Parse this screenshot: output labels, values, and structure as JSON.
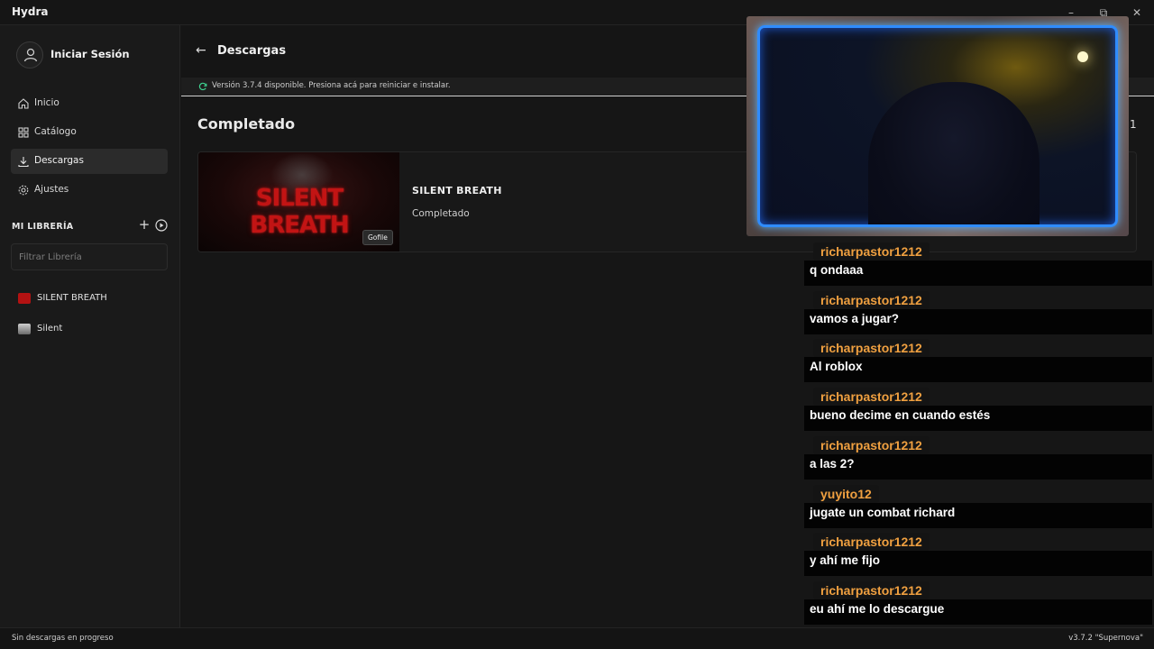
{
  "window": {
    "title": "Hydra",
    "controls": {
      "minimize": "–",
      "restore": "⧉",
      "close": "✕"
    }
  },
  "sidebar": {
    "user": {
      "label": "Iniciar Sesión",
      "icon": "user-icon"
    },
    "nav": [
      {
        "label": "Inicio",
        "icon": "home-icon",
        "active": false
      },
      {
        "label": "Catálogo",
        "icon": "grid-icon",
        "active": false
      },
      {
        "label": "Descargas",
        "icon": "download-icon",
        "active": true
      },
      {
        "label": "Ajustes",
        "icon": "gear-icon",
        "active": false
      }
    ],
    "library": {
      "heading": "MI LIBRERÍA",
      "add": "+",
      "filter_placeholder": "Filtrar Librería",
      "items": [
        {
          "label": "SILENT BREATH",
          "thumb_color": "#b31212"
        },
        {
          "label": "Silent",
          "thumb_color": "#8a8a8a"
        }
      ]
    }
  },
  "header": {
    "back": "←",
    "title": "Descargas"
  },
  "update_banner": {
    "text": "Versión 3.7.4 disponible. Presiona acá para reiniciar e instalar.",
    "icon": "sync-icon"
  },
  "downloads": {
    "section_title": "Completado",
    "count": "1",
    "items": [
      {
        "logo_text": "SILENT BREATH",
        "source_badge": "Gofile",
        "name": "SILENT BREATH",
        "status": "Completado"
      }
    ]
  },
  "chat": {
    "username_color": "#f0a040",
    "messages": [
      {
        "user": "richarpastor1212",
        "text": "q ondaaa"
      },
      {
        "user": "richarpastor1212",
        "text": "vamos a jugar?"
      },
      {
        "user": "richarpastor1212",
        "text": "Al roblox"
      },
      {
        "user": "richarpastor1212",
        "text": "bueno decime en cuando estés"
      },
      {
        "user": "richarpastor1212",
        "text": "a las 2?"
      },
      {
        "user": "yuyito12",
        "text": "jugate un combat richard"
      },
      {
        "user": "richarpastor1212",
        "text": "y ahí me fijo"
      },
      {
        "user": "richarpastor1212",
        "text": "eu ahí me lo descargue"
      }
    ]
  },
  "statusbar": {
    "left": "Sin descargas en progreso",
    "right": "v3.7.2 \"Supernova\""
  }
}
